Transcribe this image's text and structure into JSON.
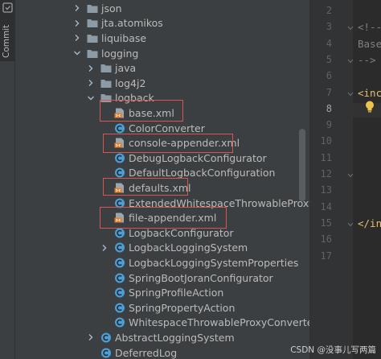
{
  "sidebar": {
    "commit_label": "Commit"
  },
  "tree": {
    "rows": [
      {
        "label": "json",
        "kind": "folder",
        "depth": 1,
        "expanded": false
      },
      {
        "label": "jta.atomikos",
        "kind": "folder",
        "depth": 1,
        "expanded": false
      },
      {
        "label": "liquibase",
        "kind": "folder",
        "depth": 1,
        "expanded": false
      },
      {
        "label": "logging",
        "kind": "folder",
        "depth": 1,
        "expanded": true
      },
      {
        "label": "java",
        "kind": "folder",
        "depth": 2,
        "expanded": false
      },
      {
        "label": "log4j2",
        "kind": "folder",
        "depth": 2,
        "expanded": false
      },
      {
        "label": "logback",
        "kind": "folder",
        "depth": 2,
        "expanded": true
      },
      {
        "label": "base.xml",
        "kind": "xml",
        "depth": 3
      },
      {
        "label": "ColorConverter",
        "kind": "class",
        "depth": 3
      },
      {
        "label": "console-appender.xml",
        "kind": "xml",
        "depth": 3
      },
      {
        "label": "DebugLogbackConfigurator",
        "kind": "class",
        "depth": 3
      },
      {
        "label": "DefaultLogbackConfiguration",
        "kind": "class",
        "depth": 3
      },
      {
        "label": "defaults.xml",
        "kind": "xml",
        "depth": 3
      },
      {
        "label": "ExtendedWhitespaceThrowableProxyConverter",
        "kind": "class",
        "depth": 3
      },
      {
        "label": "file-appender.xml",
        "kind": "xml",
        "depth": 3
      },
      {
        "label": "LogbackConfigurator",
        "kind": "class",
        "depth": 3
      },
      {
        "label": "LogbackLoggingSystem",
        "kind": "class",
        "depth": 3,
        "expandable": true
      },
      {
        "label": "LogbackLoggingSystemProperties",
        "kind": "class",
        "depth": 3
      },
      {
        "label": "SpringBootJoranConfigurator",
        "kind": "class",
        "depth": 3
      },
      {
        "label": "SpringProfileAction",
        "kind": "class",
        "depth": 3
      },
      {
        "label": "SpringPropertyAction",
        "kind": "class",
        "depth": 3
      },
      {
        "label": "WhitespaceThrowableProxyConverter",
        "kind": "class",
        "depth": 3
      },
      {
        "label": "AbstractLoggingSystem",
        "kind": "class",
        "depth": 2,
        "expandable": true
      },
      {
        "label": "DeferredLog",
        "kind": "class",
        "depth": 2
      }
    ]
  },
  "editor": {
    "line_numbers": [
      "2",
      "3",
      "4",
      "5",
      "6",
      "7",
      "8",
      "9",
      "10",
      "11",
      "12",
      "13",
      "14",
      "15",
      "16",
      "17"
    ],
    "current_line": "8",
    "code": [
      {
        "line": "3",
        "text": "<!--",
        "cls": "cm"
      },
      {
        "line": "4",
        "text": "Base",
        "cls": "cm"
      },
      {
        "line": "5",
        "text": "-->",
        "cls": "cm"
      },
      {
        "line": "7",
        "text": "<inc",
        "cls": "tag"
      },
      {
        "line": "15",
        "text": "</in",
        "cls": "tag"
      }
    ]
  },
  "colors": {
    "folder": "#8c9ba6",
    "class_icon": "#4a9fd8",
    "xml_icon": "#e57e2b",
    "highlight": "#d9534f"
  },
  "watermark": "CSDN @没事儿写两篇"
}
